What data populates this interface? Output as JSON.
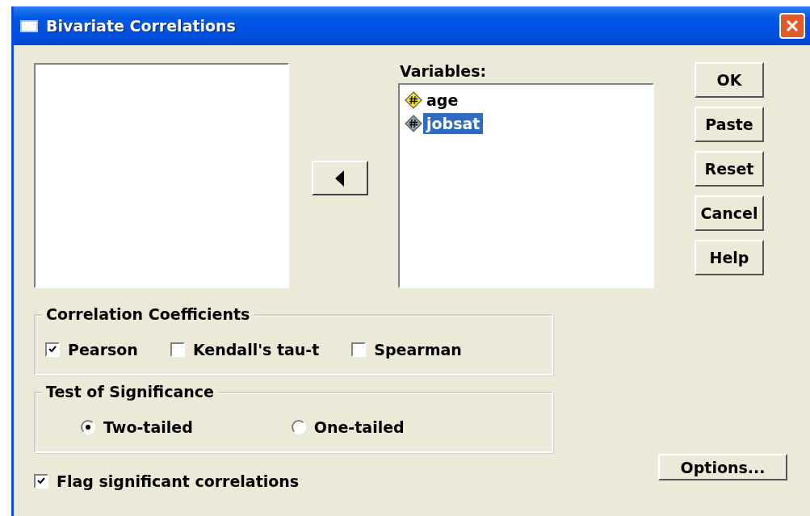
{
  "window": {
    "title": "Bivariate Correlations"
  },
  "variables": {
    "label": "Variables:",
    "items": [
      {
        "name": "age",
        "selected": false
      },
      {
        "name": "jobsat",
        "selected": true
      }
    ]
  },
  "buttons": [
    "OK",
    "Paste",
    "Reset",
    "Cancel",
    "Help"
  ],
  "correlation_coefficients": {
    "title": "Correlation Coefficients",
    "options": [
      {
        "label": "Pearson",
        "checked": true
      },
      {
        "label": "Kendall's tau-t",
        "checked": false
      },
      {
        "label": "Spearman",
        "checked": false
      }
    ]
  },
  "test_of_significance": {
    "title": "Test of Significance",
    "options": [
      {
        "label": "Two-tailed",
        "selected": true
      },
      {
        "label": "One-tailed",
        "selected": false
      }
    ]
  },
  "flag": {
    "label": "Flag significant correlations",
    "checked": true
  },
  "options_button": "Options..."
}
